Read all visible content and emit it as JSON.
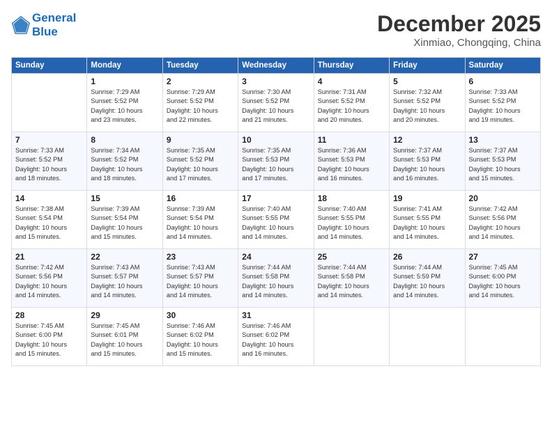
{
  "header": {
    "logo_line1": "General",
    "logo_line2": "Blue",
    "month": "December 2025",
    "location": "Xinmiao, Chongqing, China"
  },
  "days_of_week": [
    "Sunday",
    "Monday",
    "Tuesday",
    "Wednesday",
    "Thursday",
    "Friday",
    "Saturday"
  ],
  "weeks": [
    [
      {
        "day": "",
        "text": ""
      },
      {
        "day": "1",
        "text": "Sunrise: 7:29 AM\nSunset: 5:52 PM\nDaylight: 10 hours\nand 23 minutes."
      },
      {
        "day": "2",
        "text": "Sunrise: 7:29 AM\nSunset: 5:52 PM\nDaylight: 10 hours\nand 22 minutes."
      },
      {
        "day": "3",
        "text": "Sunrise: 7:30 AM\nSunset: 5:52 PM\nDaylight: 10 hours\nand 21 minutes."
      },
      {
        "day": "4",
        "text": "Sunrise: 7:31 AM\nSunset: 5:52 PM\nDaylight: 10 hours\nand 20 minutes."
      },
      {
        "day": "5",
        "text": "Sunrise: 7:32 AM\nSunset: 5:52 PM\nDaylight: 10 hours\nand 20 minutes."
      },
      {
        "day": "6",
        "text": "Sunrise: 7:33 AM\nSunset: 5:52 PM\nDaylight: 10 hours\nand 19 minutes."
      }
    ],
    [
      {
        "day": "7",
        "text": "Sunrise: 7:33 AM\nSunset: 5:52 PM\nDaylight: 10 hours\nand 18 minutes."
      },
      {
        "day": "8",
        "text": "Sunrise: 7:34 AM\nSunset: 5:52 PM\nDaylight: 10 hours\nand 18 minutes."
      },
      {
        "day": "9",
        "text": "Sunrise: 7:35 AM\nSunset: 5:52 PM\nDaylight: 10 hours\nand 17 minutes."
      },
      {
        "day": "10",
        "text": "Sunrise: 7:35 AM\nSunset: 5:53 PM\nDaylight: 10 hours\nand 17 minutes."
      },
      {
        "day": "11",
        "text": "Sunrise: 7:36 AM\nSunset: 5:53 PM\nDaylight: 10 hours\nand 16 minutes."
      },
      {
        "day": "12",
        "text": "Sunrise: 7:37 AM\nSunset: 5:53 PM\nDaylight: 10 hours\nand 16 minutes."
      },
      {
        "day": "13",
        "text": "Sunrise: 7:37 AM\nSunset: 5:53 PM\nDaylight: 10 hours\nand 15 minutes."
      }
    ],
    [
      {
        "day": "14",
        "text": "Sunrise: 7:38 AM\nSunset: 5:54 PM\nDaylight: 10 hours\nand 15 minutes."
      },
      {
        "day": "15",
        "text": "Sunrise: 7:39 AM\nSunset: 5:54 PM\nDaylight: 10 hours\nand 15 minutes."
      },
      {
        "day": "16",
        "text": "Sunrise: 7:39 AM\nSunset: 5:54 PM\nDaylight: 10 hours\nand 14 minutes."
      },
      {
        "day": "17",
        "text": "Sunrise: 7:40 AM\nSunset: 5:55 PM\nDaylight: 10 hours\nand 14 minutes."
      },
      {
        "day": "18",
        "text": "Sunrise: 7:40 AM\nSunset: 5:55 PM\nDaylight: 10 hours\nand 14 minutes."
      },
      {
        "day": "19",
        "text": "Sunrise: 7:41 AM\nSunset: 5:55 PM\nDaylight: 10 hours\nand 14 minutes."
      },
      {
        "day": "20",
        "text": "Sunrise: 7:42 AM\nSunset: 5:56 PM\nDaylight: 10 hours\nand 14 minutes."
      }
    ],
    [
      {
        "day": "21",
        "text": "Sunrise: 7:42 AM\nSunset: 5:56 PM\nDaylight: 10 hours\nand 14 minutes."
      },
      {
        "day": "22",
        "text": "Sunrise: 7:43 AM\nSunset: 5:57 PM\nDaylight: 10 hours\nand 14 minutes."
      },
      {
        "day": "23",
        "text": "Sunrise: 7:43 AM\nSunset: 5:57 PM\nDaylight: 10 hours\nand 14 minutes."
      },
      {
        "day": "24",
        "text": "Sunrise: 7:44 AM\nSunset: 5:58 PM\nDaylight: 10 hours\nand 14 minutes."
      },
      {
        "day": "25",
        "text": "Sunrise: 7:44 AM\nSunset: 5:58 PM\nDaylight: 10 hours\nand 14 minutes."
      },
      {
        "day": "26",
        "text": "Sunrise: 7:44 AM\nSunset: 5:59 PM\nDaylight: 10 hours\nand 14 minutes."
      },
      {
        "day": "27",
        "text": "Sunrise: 7:45 AM\nSunset: 6:00 PM\nDaylight: 10 hours\nand 14 minutes."
      }
    ],
    [
      {
        "day": "28",
        "text": "Sunrise: 7:45 AM\nSunset: 6:00 PM\nDaylight: 10 hours\nand 15 minutes."
      },
      {
        "day": "29",
        "text": "Sunrise: 7:45 AM\nSunset: 6:01 PM\nDaylight: 10 hours\nand 15 minutes."
      },
      {
        "day": "30",
        "text": "Sunrise: 7:46 AM\nSunset: 6:02 PM\nDaylight: 10 hours\nand 15 minutes."
      },
      {
        "day": "31",
        "text": "Sunrise: 7:46 AM\nSunset: 6:02 PM\nDaylight: 10 hours\nand 16 minutes."
      },
      {
        "day": "",
        "text": ""
      },
      {
        "day": "",
        "text": ""
      },
      {
        "day": "",
        "text": ""
      }
    ]
  ]
}
